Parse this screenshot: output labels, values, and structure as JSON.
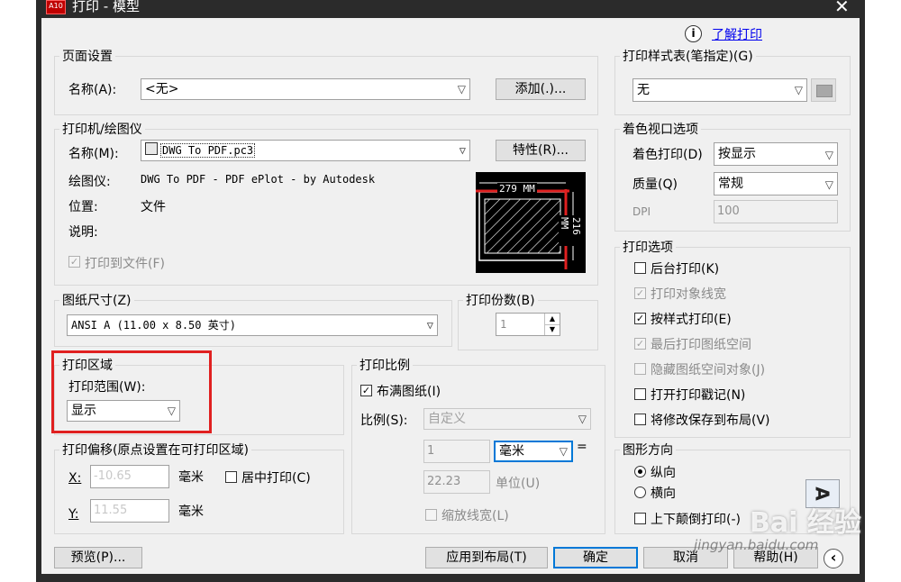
{
  "window": {
    "title": "打印 - 模型",
    "app_badge": "A10",
    "close": "✕"
  },
  "help_link": {
    "icon": "ⓘ",
    "text": "了解打印"
  },
  "page_setup": {
    "title": "页面设置",
    "name_label": "名称(A):",
    "name_value": "<无>",
    "add_button": "添加(.)..."
  },
  "printer": {
    "title": "打印机/绘图仪",
    "name_label": "名称(M):",
    "name_value": "DWG To PDF.pc3",
    "properties_button": "特性(R)...",
    "plotter_label": "绘图仪:",
    "plotter_value": "DWG To PDF - PDF ePlot - by Autodesk",
    "location_label": "位置:",
    "location_value": "文件",
    "description_label": "说明:",
    "print_to_file": "打印到文件(F)",
    "preview_width": "279 MM",
    "preview_height": "216 MM"
  },
  "paper_size": {
    "title": "图纸尺寸(Z)",
    "value": "ANSI A (11.00 x 8.50 英寸)"
  },
  "copies": {
    "title": "打印份数(B)",
    "value": "1"
  },
  "plot_area": {
    "title": "打印区域",
    "range_label": "打印范围(W):",
    "range_value": "显示"
  },
  "plot_offset": {
    "title": "打印偏移(原点设置在可打印区域)",
    "x_label": "X:",
    "x_value": "-10.65",
    "x_unit": "毫米",
    "y_label": "Y:",
    "y_value": "11.55",
    "y_unit": "毫米",
    "center_label": "居中打印(C)"
  },
  "plot_scale": {
    "title": "打印比例",
    "fit_label": "布满图纸(I)",
    "scale_label": "比例(S):",
    "scale_value": "自定义",
    "value1": "1",
    "unit1": "毫米",
    "equals": "=",
    "value2": "22.23",
    "unit2": "单位(U)",
    "lineweights": "缩放线宽(L)"
  },
  "style_table": {
    "title": "打印样式表(笔指定)(G)",
    "value": "无"
  },
  "shaded_viewport": {
    "title": "着色视口选项",
    "shade_label": "着色打印(D)",
    "shade_value": "按显示",
    "quality_label": "质量(Q)",
    "quality_value": "常规",
    "dpi_label": "DPI",
    "dpi_value": "100"
  },
  "plot_options": {
    "title": "打印选项",
    "items": [
      {
        "label": "后台打印(K)",
        "checked": "",
        "disabled": false
      },
      {
        "label": "打印对象线宽",
        "checked": "✓",
        "disabled": true
      },
      {
        "label": "按样式打印(E)",
        "checked": "✓",
        "disabled": false
      },
      {
        "label": "最后打印图纸空间",
        "checked": "✓",
        "disabled": true
      },
      {
        "label": "隐藏图纸空间对象(J)",
        "checked": "",
        "disabled": true
      },
      {
        "label": "打开打印戳记(N)",
        "checked": "",
        "disabled": false
      },
      {
        "label": "将修改保存到布局(V)",
        "checked": "",
        "disabled": false
      }
    ]
  },
  "orientation": {
    "title": "图形方向",
    "portrait": "纵向",
    "landscape": "横向",
    "upside_down": "上下颠倒打印(-)",
    "icon_letter": "A"
  },
  "footer": {
    "preview": "预览(P)...",
    "apply": "应用到布局(T)",
    "ok": "确定",
    "cancel": "取消",
    "help": "帮助(H)",
    "more": "‹"
  },
  "watermark": {
    "brand": "Bai 经验",
    "url": "jingyan.baidu.com"
  }
}
